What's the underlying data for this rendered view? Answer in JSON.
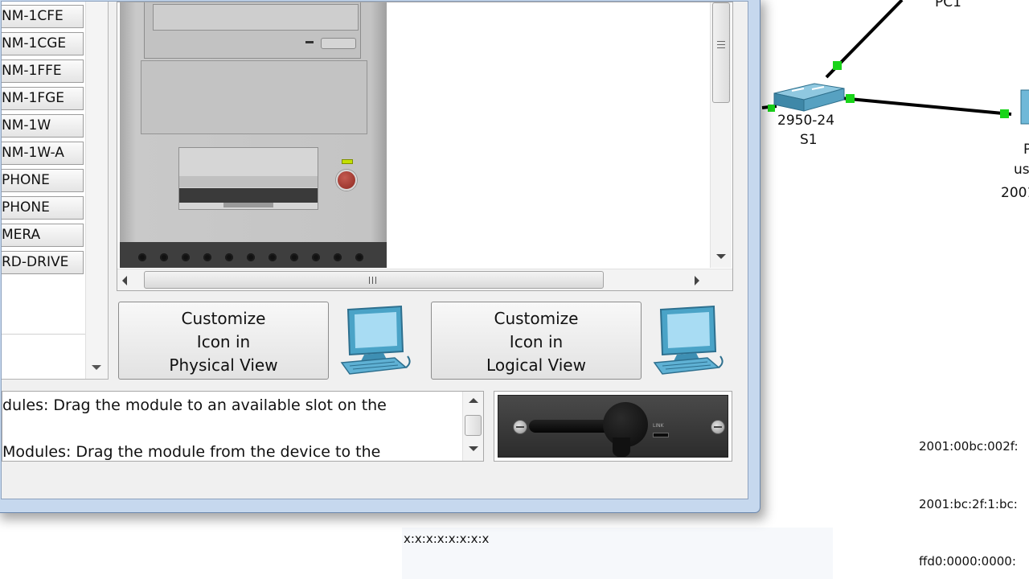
{
  "dialog": {
    "module_list": {
      "items": [
        "NM-1CFE",
        "NM-1CGE",
        "NM-1FFE",
        "NM-1FGE",
        "NM-1W",
        "NM-1W-A",
        "PHONE",
        "PHONE",
        "MERA",
        "RD-DRIVE"
      ]
    },
    "buttons": {
      "customize_physical": [
        "Customize",
        "Icon in",
        "Physical View"
      ],
      "customize_logical": [
        "Customize",
        "Icon in",
        "Logical View"
      ]
    },
    "instructions": {
      "line1": "dules: Drag the module to an available slot on the",
      "line2": "Modules: Drag the module from the device to the"
    },
    "module_preview": {
      "link_label": "LINK"
    }
  },
  "topology": {
    "switch_model": "2950-24",
    "switch_name": "S1",
    "pc1_label": "PC1",
    "right_device_letter": "P",
    "right_device_user": "us",
    "right_device_addr": "2001",
    "link_colors": {
      "cable": "#000000",
      "link_up": "#19d419"
    },
    "addresses": [
      "2001:00bc:002f:",
      "2001:bc:2f:1:bc:",
      "ffd0:0000:0000:"
    ],
    "bottom_text": "x:x:x:x:x:x:x:x"
  },
  "colors": {
    "dialog_frame": "#c6d8ee",
    "dialog_bg": "#f0f0f0",
    "monitor_screen": "#9fd3f0",
    "monitor_body": "#4aa3c7"
  }
}
